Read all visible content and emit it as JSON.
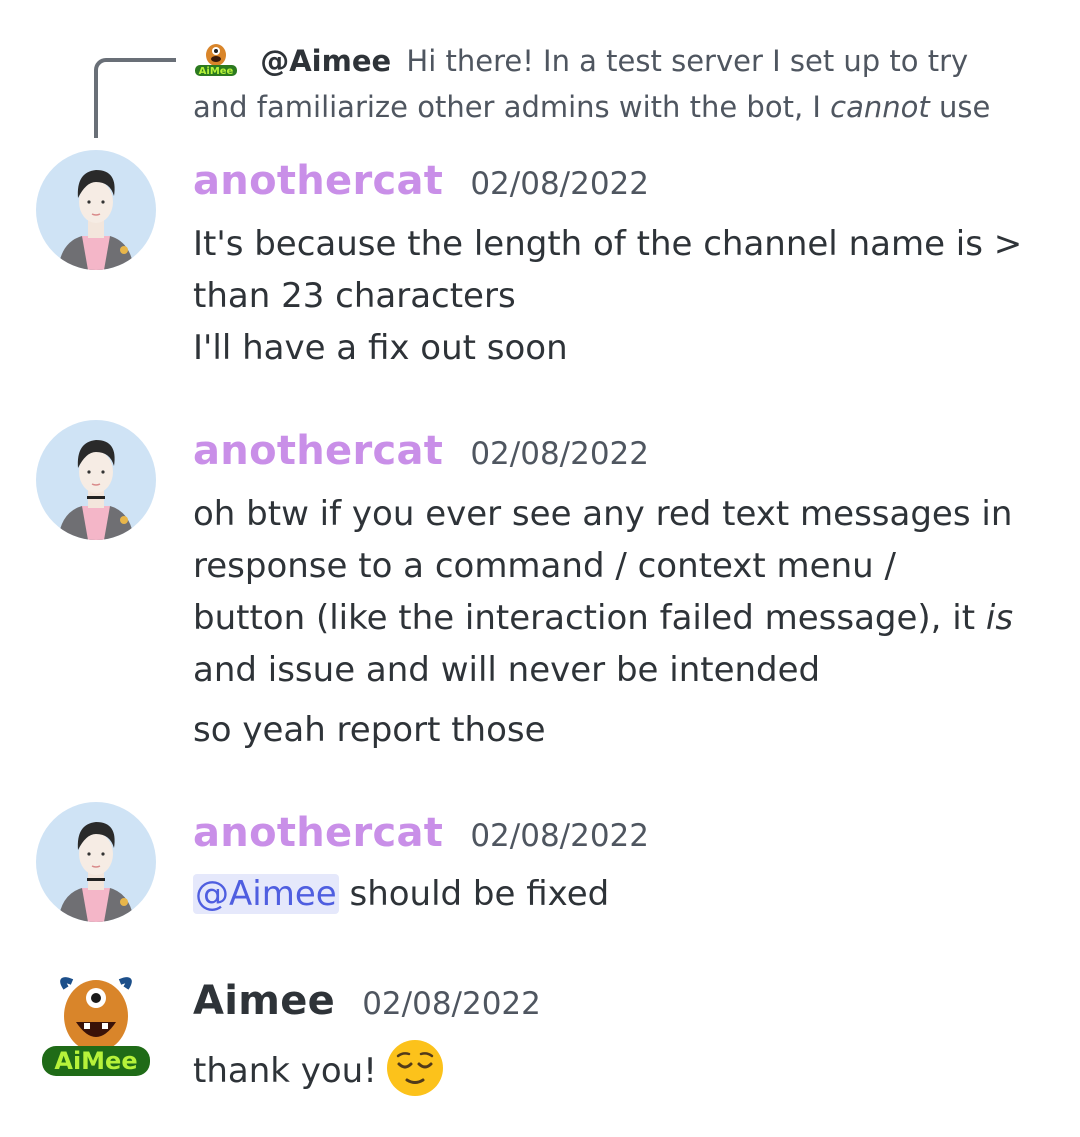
{
  "reply": {
    "author": "@Aimee",
    "line1": "Hi there!  In a test server I set up to try",
    "line2_a": "and familiarize other admins with the bot, I ",
    "line2_em": "cannot",
    "line2_b": " use"
  },
  "messages": [
    {
      "username": "anothercat",
      "timestamp": "02/08/2022",
      "lines": [
        "It's because the length of the channel name is >",
        "than 23 characters",
        "I'll have a fix out soon"
      ]
    },
    {
      "username": "anothercat",
      "timestamp": "02/08/2022",
      "line1": "oh btw if you ever see any red text messages in",
      "line2": "response to a command / context menu /",
      "line3_a": "button (like the interaction failed message), it ",
      "line3_em": "is",
      "line4": "and issue and will never be intended",
      "line5": "so yeah report those"
    },
    {
      "username": "anothercat",
      "timestamp": "02/08/2022",
      "mention": "@Aimee",
      "text": " should be fixed"
    },
    {
      "username": "Aimee",
      "timestamp": "02/08/2022",
      "text": "thank you!",
      "emoji": "relieved-face-emoji"
    }
  ],
  "bot_avatar_text": "AiMee",
  "colors": {
    "username": "#c98fe8",
    "mention_bg": "#e5e8fb",
    "mention_fg": "#4f5ee0",
    "text": "#2e3338",
    "muted": "#4f5660"
  }
}
